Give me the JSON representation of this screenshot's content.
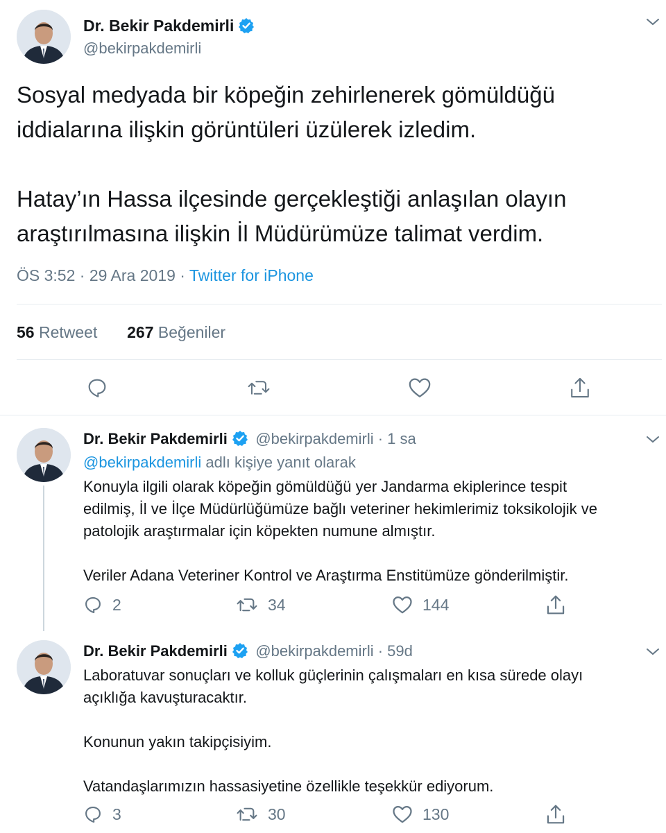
{
  "main_tweet": {
    "author_name": "Dr. Bekir Pakdemirli",
    "handle": "@bekirpakdemirli",
    "text_line1": "Sosyal medyada bir köpeğin zehirlenerek gömüldüğü",
    "text_line2": "iddialarına ilişkin görüntüleri üzülerek izledim.",
    "text_line3": "Hatay’ın Hassa ilçesinde gerçekleştiği anlaşılan olayın",
    "text_line4": "araştırılmasına ilişkin İl Müdürümüze talimat verdim.",
    "timestamp": "ÖS 3:52 · 29 Ara 2019 · ",
    "source": "Twitter for iPhone",
    "retweets": "56",
    "retweets_label": "Retweet",
    "likes": "267",
    "likes_label": "Beğeniler"
  },
  "replies": [
    {
      "author_name": "Dr. Bekir Pakdemirli",
      "handle": "@bekirpakdemirli",
      "time": " · 1 sa",
      "reply_to_handle": "@bekirpakdemirli",
      "reply_to_suffix": " adlı kişiye yanıt olarak",
      "lines": [
        "Konuyla ilgili olarak köpeğin gömüldüğü yer Jandarma ekiplerince tespit",
        "edilmiş, İl ve İlçe Müdürlüğümüze bağlı veteriner hekimlerimiz toksikolojik ve",
        "patolojik araştırmalar için köpekten numune almıştır.",
        "Veriler Adana Veteriner Kontrol ve Araştırma Enstitümüze gönderilmiştir."
      ],
      "reply_count": "2",
      "retweet_count": "34",
      "like_count": "144"
    },
    {
      "author_name": "Dr. Bekir Pakdemirli",
      "handle": "@bekirpakdemirli",
      "time": " · 59d",
      "lines": [
        "Laboratuvar sonuçları ve kolluk güçlerinin çalışmaları en kısa sürede olayı",
        "açıklığa kavuşturacaktır.",
        "Konunun yakın takipçisiyim.",
        "Vatandaşlarımızın hassasiyetine özellikle teşekkür ediyorum."
      ],
      "reply_count": "3",
      "retweet_count": "30",
      "like_count": "130"
    }
  ],
  "colors": {
    "link": "#1b95e0",
    "muted": "#657786",
    "text": "#14171a",
    "verified": "#1da1f2"
  },
  "icons": [
    "chevron-down-icon",
    "verified-badge-icon",
    "reply-icon",
    "retweet-icon",
    "like-icon",
    "share-icon"
  ]
}
